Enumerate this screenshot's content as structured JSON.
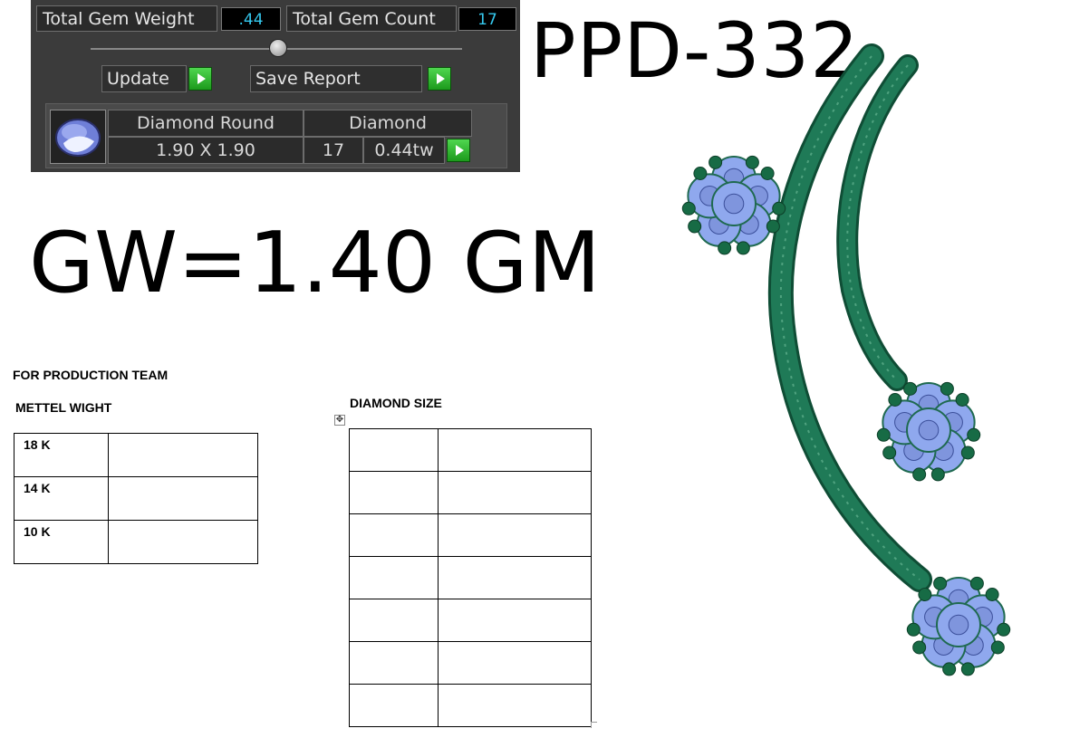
{
  "gem_panel": {
    "total_weight_label": "Total Gem Weight",
    "total_weight_value": ".44",
    "total_count_label": "Total Gem Count",
    "total_count_value": "17",
    "update_label": "Update",
    "save_report_label": "Save Report",
    "gem": {
      "shape": "Diamond Round",
      "material": "Diamond",
      "size": "1.90 X 1.90",
      "count": "17",
      "weight": "0.44tw"
    }
  },
  "design_code": "PPD-332",
  "gross_weight": "GW=1.40 GM",
  "production": {
    "team_heading": "FOR PRODUCTION TEAM",
    "metal_heading": "METTEL WIGHT",
    "metal_rows": [
      {
        "karat": "18 K",
        "value": ""
      },
      {
        "karat": "14 K",
        "value": ""
      },
      {
        "karat": "10 K",
        "value": ""
      }
    ],
    "diamond_heading": "DIAMOND SIZE",
    "diamond_rows": 7
  },
  "colors": {
    "panel_bg": "#3b3b3b",
    "value_text": "#35c8ee",
    "button_green": "#2db82d",
    "metal_green": "#1f7a57",
    "gem_blue": "#8fa8ee",
    "prong_green": "#176b45"
  }
}
